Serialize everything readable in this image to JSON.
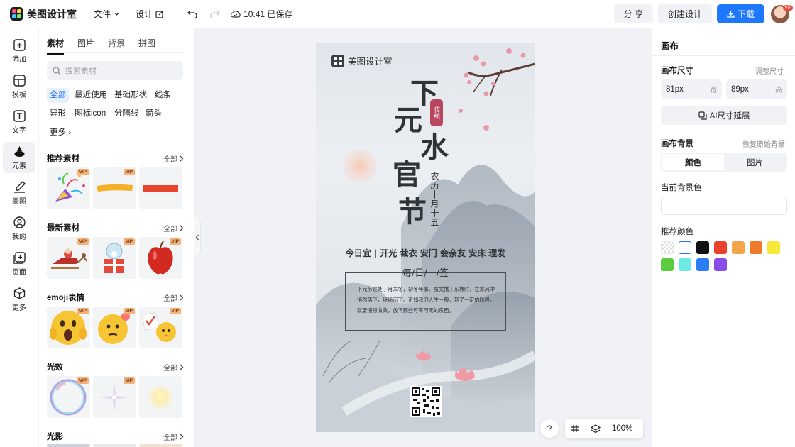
{
  "app": {
    "name": "美图设计室",
    "menu": [
      "文件",
      "设计"
    ],
    "saved_status": "10:41 已保存",
    "share": "分 享",
    "create": "创建设计",
    "download": "下载",
    "avatar_badge": "VIP"
  },
  "iconbar": [
    {
      "label": "添加",
      "icon": "plus-square-icon"
    },
    {
      "label": "模板",
      "icon": "template-icon"
    },
    {
      "label": "文字",
      "icon": "text-icon"
    },
    {
      "label": "元素",
      "icon": "shapes-icon",
      "active": true
    },
    {
      "label": "画图",
      "icon": "draw-icon"
    },
    {
      "label": "我的",
      "icon": "user-icon"
    },
    {
      "label": "页面",
      "icon": "page-icon"
    },
    {
      "label": "更多",
      "icon": "cube-icon"
    }
  ],
  "left_panel": {
    "tabs": [
      "素材",
      "图片",
      "背景",
      "拼图"
    ],
    "active_tab": "素材",
    "search_placeholder": "搜索素材",
    "chips": [
      "全部",
      "最近使用",
      "基础形状",
      "线条",
      "异形",
      "图标icon",
      "分隔线",
      "箭头",
      "更多"
    ],
    "all_label": "全部",
    "vip_label": "VIP",
    "sections": [
      {
        "title": "推荐素材",
        "items": [
          "party-popper",
          "yellow-brush-stroke",
          "red-rectangle"
        ]
      },
      {
        "title": "最新素材",
        "items": [
          "santa-sleigh",
          "gift-box-globe",
          "red-apple"
        ]
      },
      {
        "title": "emoji表情",
        "items": [
          "shocked-emoji",
          "thinking-emoji",
          "chick-emoji"
        ]
      },
      {
        "title": "光效",
        "items": [
          "rainbow-bubble",
          "sparkle-star",
          "glow-light"
        ]
      },
      {
        "title": "光影",
        "items": []
      }
    ]
  },
  "canvas": {
    "logo_text": "美图设计室",
    "big_chars": [
      "下",
      "元",
      "水",
      "官",
      "节"
    ],
    "seal_text": "传统",
    "date_text": "农历十月十五",
    "yi_text": "今日宜 | 开光 裁衣 安门 会亲友 安床 理发",
    "box_title": "每/日/一/签",
    "box_body": "下元节是处于月末冬，初冬年事。蚕文播于东坡时，在寒风中悄然落下，纷纷而下。正如我们人生一般，到了一定的阶段，就要懂得收敛，放下那些可有可无的东西。"
  },
  "canvas_tools": {
    "help": "?",
    "zoom": "100%"
  },
  "right_panel": {
    "title": "画布",
    "size_label": "画布尺寸",
    "adjust_size": "调整尺寸",
    "width_value": "81px",
    "width_unit": "宽",
    "height_value": "89px",
    "height_unit": "高",
    "ai_button": "AI尺寸延展",
    "bg_label": "画布背景",
    "restore_bg": "恢复原始背景",
    "seg_color": "颜色",
    "seg_image": "图片",
    "current_bg_label": "当前背景色",
    "recommend_label": "推荐颜色",
    "swatches": [
      "transparent",
      "#ffffff",
      "#111111",
      "#e9432f",
      "#f4a54c",
      "#ee7a2d",
      "#f7e83c",
      "#5ccc3f",
      "#6de9e6",
      "#2b7df3",
      "#8a4ce6"
    ]
  },
  "colors": {
    "accent": "#1e78ff",
    "active_chip_bg": "#e6f0ff",
    "vip": "#f4b27b",
    "seal": "#b8465c"
  }
}
